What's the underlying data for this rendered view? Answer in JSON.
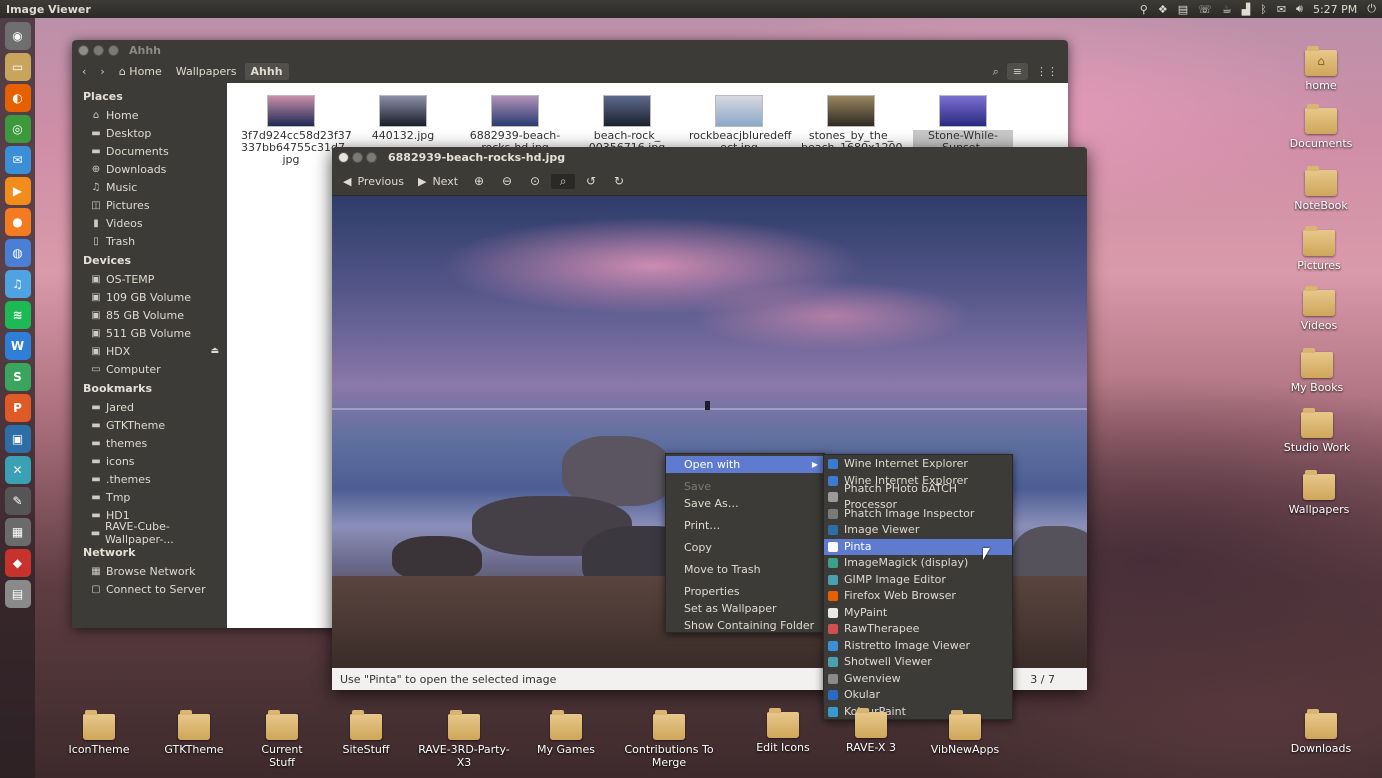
{
  "top_panel": {
    "app_title": "Image Viewer",
    "clock": "5:27 PM"
  },
  "launcher": {
    "items": [
      {
        "icon": "dash-home-icon",
        "color": "#6f6f6f"
      },
      {
        "icon": "files-icon",
        "color": "#c8a45d"
      },
      {
        "icon": "firefox-icon",
        "color": "#e66000"
      },
      {
        "icon": "chrome-icon",
        "color": "#3c9a3c"
      },
      {
        "icon": "mail-icon",
        "color": "#3a8fd6"
      },
      {
        "icon": "media-player-icon",
        "color": "#f28c1a"
      },
      {
        "icon": "orange-app-icon",
        "color": "#f57b20"
      },
      {
        "icon": "chromium-icon",
        "color": "#4a7fd6"
      },
      {
        "icon": "music-icon",
        "color": "#4fa3e0"
      },
      {
        "icon": "spotify-icon",
        "color": "#1db954"
      },
      {
        "icon": "writer-icon",
        "color": "#2f7fd8"
      },
      {
        "icon": "spreadsheet-icon",
        "color": "#3aa55c"
      },
      {
        "icon": "presentation-icon",
        "color": "#e05a26"
      },
      {
        "icon": "image-viewer-icon",
        "color": "#2c6ea5"
      },
      {
        "icon": "tools-icon",
        "color": "#3aa0b4"
      },
      {
        "icon": "pen-icon",
        "color": "#555555"
      },
      {
        "icon": "screenshot-icon",
        "color": "#6b6b6b"
      },
      {
        "icon": "ruby-icon",
        "color": "#c8322c"
      },
      {
        "icon": "drive-icon",
        "color": "#8a8a8a"
      }
    ]
  },
  "file_manager": {
    "title": "Ahhh",
    "breadcrumbs": [
      "Home",
      "Wallpapers",
      "Ahhh"
    ],
    "sidebar": {
      "places_heading": "Places",
      "places": [
        {
          "label": "Home",
          "icon": "home-icon"
        },
        {
          "label": "Desktop",
          "icon": "folder-icon"
        },
        {
          "label": "Documents",
          "icon": "folder-icon"
        },
        {
          "label": "Downloads",
          "icon": "download-icon"
        },
        {
          "label": "Music",
          "icon": "music-note-icon"
        },
        {
          "label": "Pictures",
          "icon": "camera-icon"
        },
        {
          "label": "Videos",
          "icon": "film-icon"
        },
        {
          "label": "Trash",
          "icon": "trash-icon"
        }
      ],
      "devices_heading": "Devices",
      "devices": [
        {
          "label": "OS-TEMP",
          "icon": "drive-icon"
        },
        {
          "label": "109 GB Volume",
          "icon": "drive-icon"
        },
        {
          "label": "85 GB Volume",
          "icon": "drive-icon"
        },
        {
          "label": "511 GB Volume",
          "icon": "drive-icon"
        },
        {
          "label": "HDX",
          "icon": "drive-icon"
        },
        {
          "label": "Computer",
          "icon": "computer-icon"
        }
      ],
      "bookmarks_heading": "Bookmarks",
      "bookmarks": [
        {
          "label": "Jared",
          "icon": "folder-icon"
        },
        {
          "label": "GTKTheme",
          "icon": "folder-icon"
        },
        {
          "label": "themes",
          "icon": "folder-icon"
        },
        {
          "label": "icons",
          "icon": "folder-icon"
        },
        {
          "label": ".themes",
          "icon": "folder-icon"
        },
        {
          "label": "Tmp",
          "icon": "folder-icon"
        },
        {
          "label": "HD1",
          "icon": "folder-icon"
        },
        {
          "label": "RAVE-Cube-Wallpaper-...",
          "icon": "folder-icon"
        }
      ],
      "network_heading": "Network",
      "network": [
        {
          "label": "Browse Network",
          "icon": "network-icon"
        },
        {
          "label": "Connect to Server",
          "icon": "server-icon"
        }
      ]
    },
    "files": [
      {
        "name": "3f7d924cc58d23f37 337bb64755c31d7. jpg",
        "colors": [
          "#1e2a55",
          "#c98fa9"
        ]
      },
      {
        "name": "440132.jpg",
        "colors": [
          "#1a1e2a",
          "#8a8fa6"
        ]
      },
      {
        "name": "6882939-beach- rocks-hd.jpg",
        "colors": [
          "#2a3a70",
          "#b092b8"
        ]
      },
      {
        "name": "beach-rock_ 00356716.jpg",
        "colors": [
          "#1c2130",
          "#5d6a8a"
        ]
      },
      {
        "name": "rockbeacjbluredeff ect.jpg",
        "colors": [
          "#8aa8c8",
          "#d8d8e0"
        ]
      },
      {
        "name": "stones_by_the_ beach_1680x1200",
        "colors": [
          "#2e2a22",
          "#9a8662"
        ]
      },
      {
        "name": "Stone-While-Sunset- Wallpaper-iPhone",
        "colors": [
          "#2a2a80",
          "#7a70d0"
        ]
      }
    ]
  },
  "image_viewer": {
    "title": "6882939-beach-rocks-hd.jpg",
    "toolbar": {
      "previous": "Previous",
      "next": "Next"
    },
    "status_text": "Use \"Pinta\" to open the selected image",
    "position": "3 / 7"
  },
  "context_menu": {
    "open_with": "Open with",
    "save": "Save",
    "save_as": "Save As…",
    "print": "Print…",
    "copy": "Copy",
    "move_to_trash": "Move to Trash",
    "properties": "Properties",
    "set_as_wallpaper": "Set as Wallpaper",
    "show_containing_folder": "Show Containing Folder"
  },
  "open_with_submenu": {
    "apps": [
      {
        "label": "Wine Internet Explorer",
        "color": "#3b7bd0"
      },
      {
        "label": "Wine Internet Explorer",
        "color": "#3b7bd0"
      },
      {
        "label": "Phatch PHoto bATCH Processor",
        "color": "#9a9a9a"
      },
      {
        "label": "Phatch Image Inspector",
        "color": "#7a7a7a"
      },
      {
        "label": "Image Viewer",
        "color": "#2c6ea5"
      },
      {
        "label": "Pinta",
        "color": "#ffffff"
      },
      {
        "label": "ImageMagick (display)",
        "color": "#3aa08a"
      },
      {
        "label": "GIMP Image Editor",
        "color": "#4aa0b0"
      },
      {
        "label": "Firefox Web Browser",
        "color": "#e66000"
      },
      {
        "label": "MyPaint",
        "color": "#e8e8e8"
      },
      {
        "label": "RawTherapee",
        "color": "#d05050"
      },
      {
        "label": "Ristretto Image Viewer",
        "color": "#3a8fd6"
      },
      {
        "label": "Shotwell Viewer",
        "color": "#4aa0b0"
      },
      {
        "label": "Gwenview",
        "color": "#8a8a8a"
      },
      {
        "label": "Okular",
        "color": "#2a6ac0"
      },
      {
        "label": "KolourPaint",
        "color": "#3a9ad0"
      }
    ],
    "highlighted": "Pinta"
  },
  "desktop": {
    "right_icons": [
      {
        "label": "home",
        "glyph": "⌂"
      },
      {
        "label": "Documents",
        "glyph": ""
      },
      {
        "label": "NoteBook",
        "glyph": ""
      },
      {
        "label": "Pictures",
        "glyph": ""
      },
      {
        "label": "Videos",
        "glyph": ""
      },
      {
        "label": "My Books",
        "glyph": ""
      },
      {
        "label": "Studio Work",
        "glyph": ""
      },
      {
        "label": "Wallpapers",
        "glyph": ""
      },
      {
        "label": "Downloads",
        "glyph": ""
      }
    ],
    "bottom_icons": [
      {
        "label": "IconTheme"
      },
      {
        "label": "GTKTheme"
      },
      {
        "label": "Current Stuff"
      },
      {
        "label": "SiteStuff"
      },
      {
        "label": "RAVE-3RD-Party-X3"
      },
      {
        "label": "My Games"
      },
      {
        "label": "Contributions To Merge"
      },
      {
        "label": "Edit Icons"
      },
      {
        "label": "RAVE-X 3"
      },
      {
        "label": "VibNewApps"
      }
    ]
  }
}
